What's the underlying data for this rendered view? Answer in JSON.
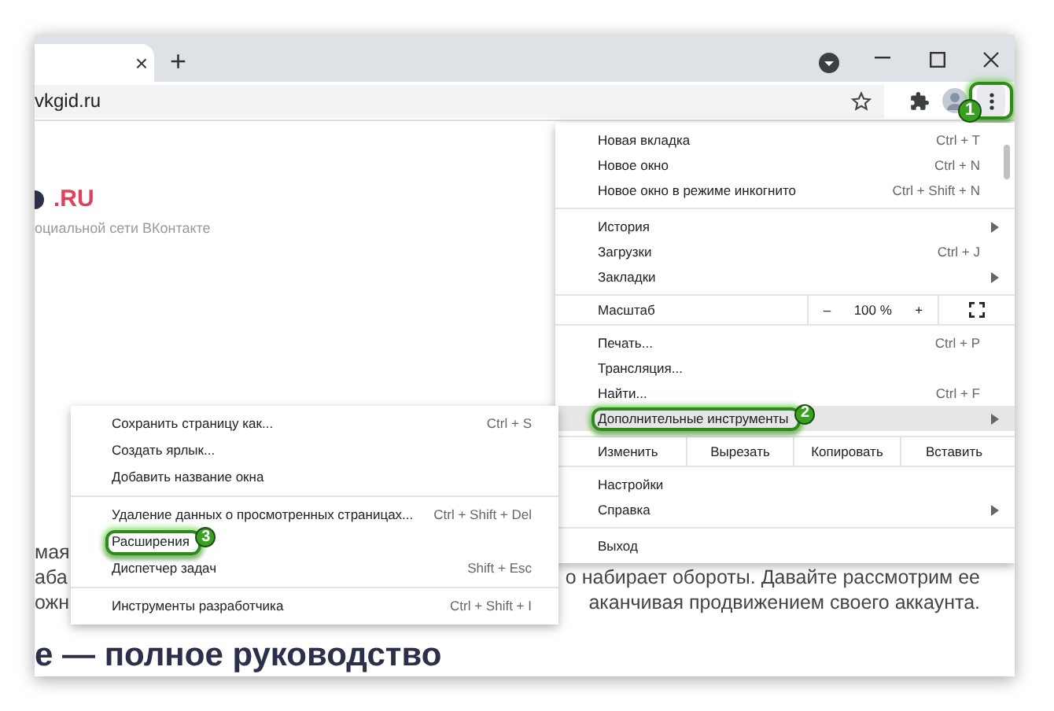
{
  "tab": {
    "close": "×"
  },
  "new_tab": "+",
  "address_bar": {
    "url": "vkgid.ru"
  },
  "toolbar": {
    "menu_callout": "1"
  },
  "page": {
    "logo_suffix": ".RU",
    "tagline": "оциальной сети ВКонтакте",
    "paragraph_lines": [
      {
        "left": "мая"
      },
      {
        "left": "аба",
        "right": "о набирает обороты. Давайте рассмотрим ее"
      },
      {
        "left": "ожн",
        "right": "аканчивая продвижением своего аккаунта."
      }
    ],
    "heading": "е — полное руководство"
  },
  "main_menu": {
    "groups": [
      [
        {
          "kind": "item",
          "label": "Новая вкладка",
          "shortcut": "Ctrl + T",
          "submenu": false,
          "highlighted": false
        },
        {
          "kind": "item",
          "label": "Новое окно",
          "shortcut": "Ctrl + N",
          "submenu": false,
          "highlighted": false
        },
        {
          "kind": "item",
          "label": "Новое окно в режиме инкогнито",
          "shortcut": "Ctrl + Shift + N",
          "submenu": false,
          "highlighted": false
        }
      ],
      [
        {
          "kind": "item",
          "label": "История",
          "submenu": true,
          "highlighted": false
        },
        {
          "kind": "item",
          "label": "Загрузки",
          "shortcut": "Ctrl + J",
          "submenu": false,
          "highlighted": false
        },
        {
          "kind": "item",
          "label": "Закладки",
          "submenu": true,
          "highlighted": false
        }
      ],
      [
        {
          "kind": "zoom",
          "label": "Масштаб",
          "minus": "–",
          "value": "100 %",
          "plus": "+"
        }
      ],
      [
        {
          "kind": "item",
          "label": "Печать...",
          "shortcut": "Ctrl + P",
          "submenu": false,
          "highlighted": false
        },
        {
          "kind": "item",
          "label": "Трансляция...",
          "submenu": false,
          "highlighted": false
        },
        {
          "kind": "item",
          "label": "Найти...",
          "shortcut": "Ctrl + F",
          "submenu": false,
          "highlighted": false
        },
        {
          "kind": "item",
          "label": "Дополнительные инструменты",
          "submenu": true,
          "highlighted": true,
          "callout": "2"
        }
      ],
      [
        {
          "kind": "edit",
          "label": "Изменить",
          "buttons": [
            "Вырезать",
            "Копировать",
            "Вставить"
          ]
        }
      ],
      [
        {
          "kind": "item",
          "label": "Настройки",
          "submenu": false,
          "highlighted": false
        },
        {
          "kind": "item",
          "label": "Справка",
          "submenu": true,
          "highlighted": false
        }
      ],
      [
        {
          "kind": "item",
          "label": "Выход",
          "submenu": false,
          "highlighted": false
        }
      ]
    ]
  },
  "submenu": {
    "groups": [
      [
        {
          "label": "Сохранить страницу как...",
          "shortcut": "Ctrl + S"
        },
        {
          "label": "Создать ярлык..."
        },
        {
          "label": "Добавить название окна"
        }
      ],
      [
        {
          "label": "Удаление данных о просмотренных страницах...",
          "shortcut": "Ctrl + Shift + Del"
        },
        {
          "label": "Расширения",
          "callout": "3"
        },
        {
          "label": "Диспетчер задач",
          "shortcut": "Shift + Esc"
        }
      ],
      [
        {
          "label": "Инструменты разработчика",
          "shortcut": "Ctrl + Shift + I"
        }
      ]
    ]
  }
}
